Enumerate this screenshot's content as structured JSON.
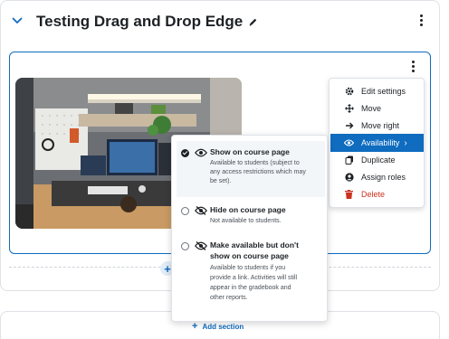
{
  "section": {
    "title": "Testing Drag and Drop Edge",
    "add_section_label": "Add section",
    "add_activity_label": "+"
  },
  "menu": {
    "items": [
      {
        "label": "Edit settings",
        "icon": "gear-icon"
      },
      {
        "label": "Move",
        "icon": "move-arrows-icon"
      },
      {
        "label": "Move right",
        "icon": "arrow-right-icon"
      },
      {
        "label": "Availability",
        "icon": "eye-icon",
        "active": true
      },
      {
        "label": "Duplicate",
        "icon": "copy-icon"
      },
      {
        "label": "Assign roles",
        "icon": "user-icon"
      },
      {
        "label": "Delete",
        "icon": "trash-icon",
        "danger": true
      }
    ]
  },
  "availability": {
    "options": [
      {
        "title": "Show on course page",
        "lines": [
          "Available to students (subject to",
          "any access restrictions which may",
          "be set)."
        ],
        "icon": "eye-icon",
        "selected": true
      },
      {
        "title": "Hide on course page",
        "lines": [
          "Not available to students."
        ],
        "icon": "eye-slash-icon",
        "selected": false
      },
      {
        "title_lines": [
          "Make available but don't",
          "show on course page"
        ],
        "lines": [
          "Available to students if you",
          "provide a link. Activities will still",
          "appear in the gradebook and",
          "other reports."
        ],
        "icon": "eye-slash-icon",
        "selected": false
      }
    ]
  },
  "colors": {
    "accent": "#0f6cbf",
    "danger": "#ca3120",
    "text": "#1d2125",
    "muted": "#495057"
  }
}
